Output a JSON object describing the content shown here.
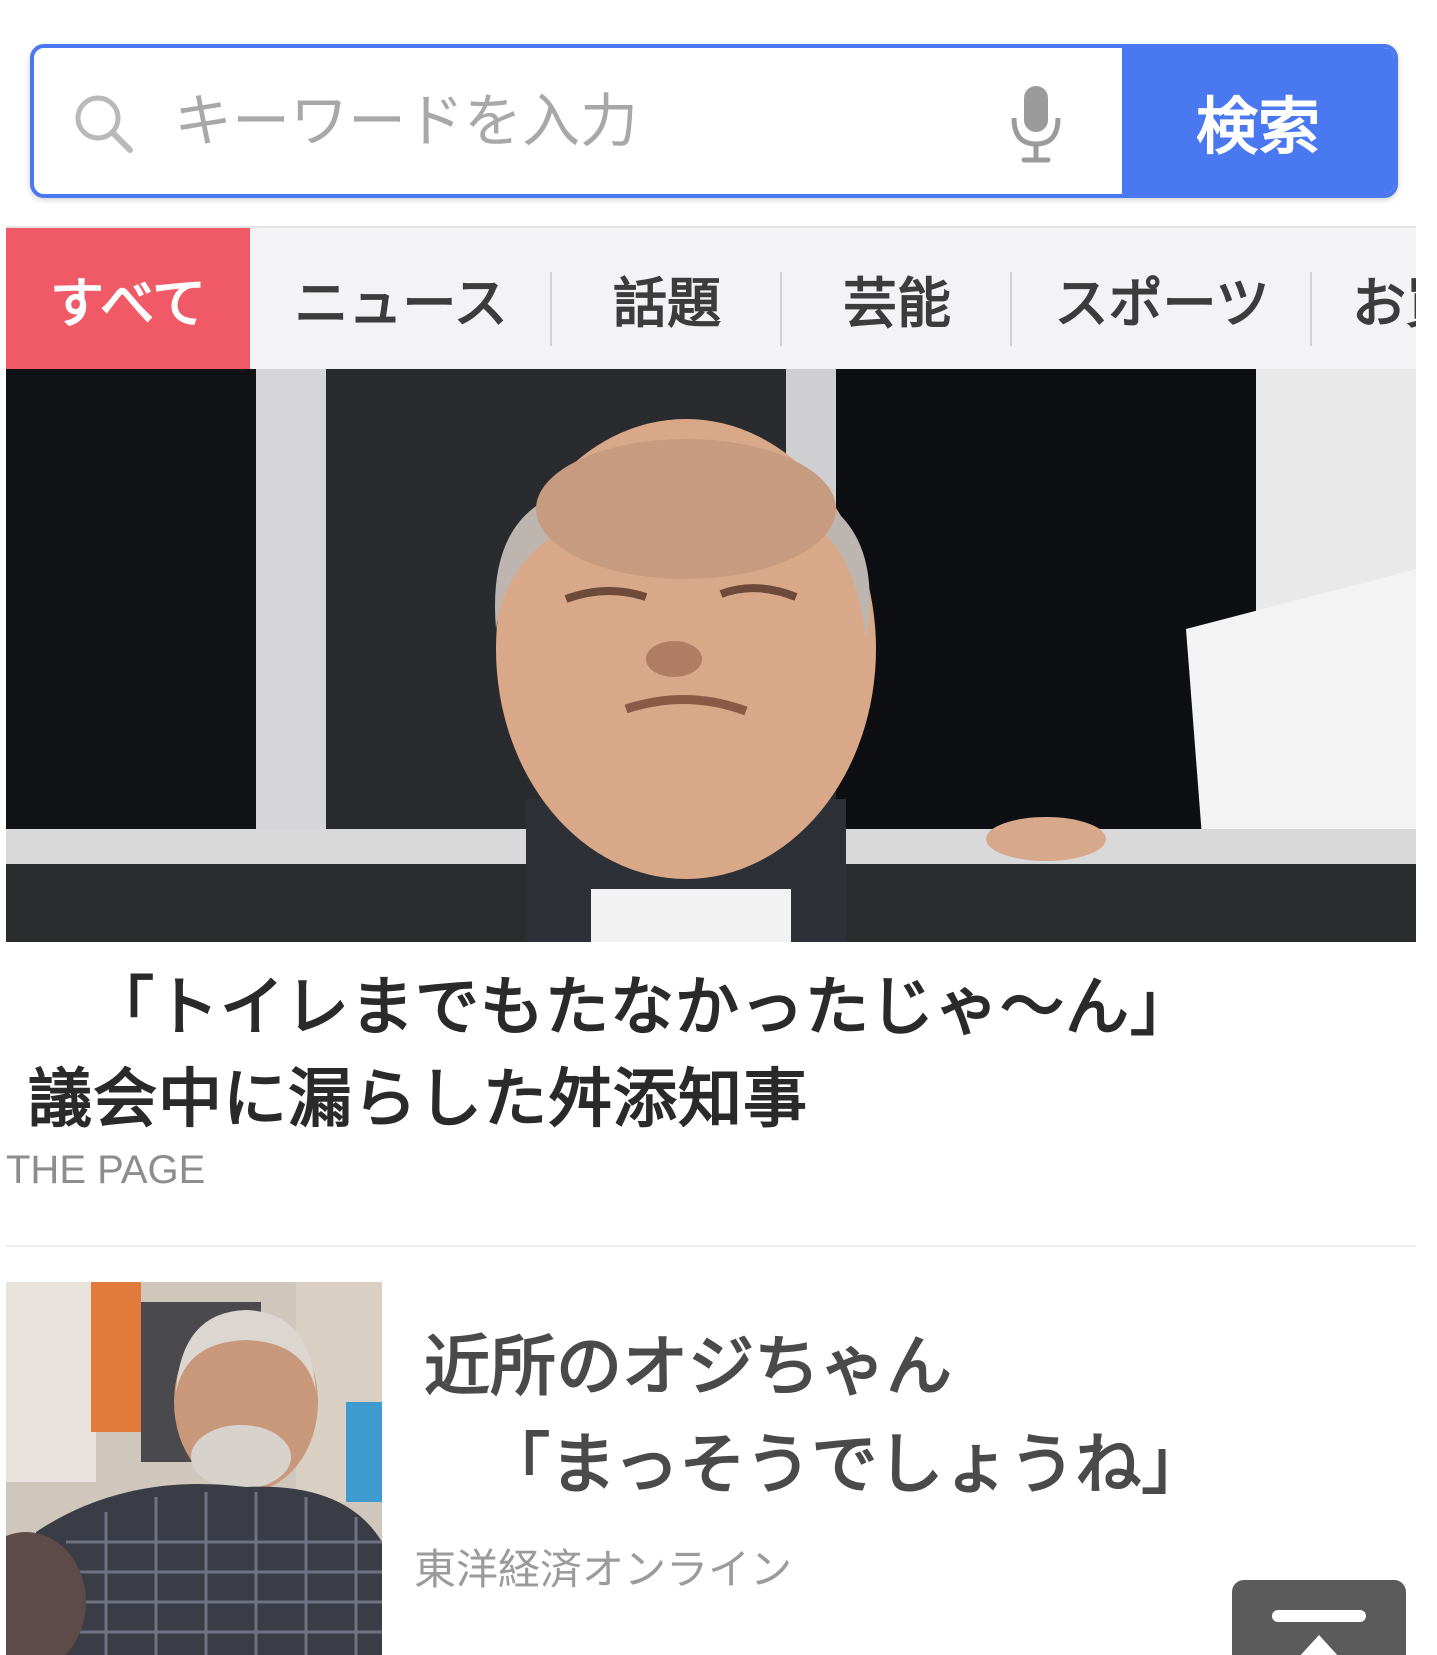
{
  "search": {
    "placeholder": "キーワードを入力",
    "button_label": "検索"
  },
  "tabs": [
    {
      "label": "すべて",
      "active": true
    },
    {
      "label": "ニュース",
      "active": false
    },
    {
      "label": "話題",
      "active": false
    },
    {
      "label": "芸能",
      "active": false
    },
    {
      "label": "スポーツ",
      "active": false
    },
    {
      "label": "お買",
      "active": false
    }
  ],
  "hero": {
    "title_line1": "「トイレまでもたなかったじゃ〜ん」",
    "title_line2": "議会中に漏らした舛添知事",
    "source": "THE PAGE"
  },
  "article": {
    "title_line1": "近所のオジちゃん",
    "title_line2": "「まっそうでしょうね」",
    "source": "東洋経済オンライン"
  },
  "colors": {
    "accent": "#4a78f0",
    "active_tab": "#ef5a66",
    "tab_bg": "#f3f3f5"
  },
  "icons": [
    "search-icon",
    "mic-icon",
    "back-to-top-icon"
  ]
}
